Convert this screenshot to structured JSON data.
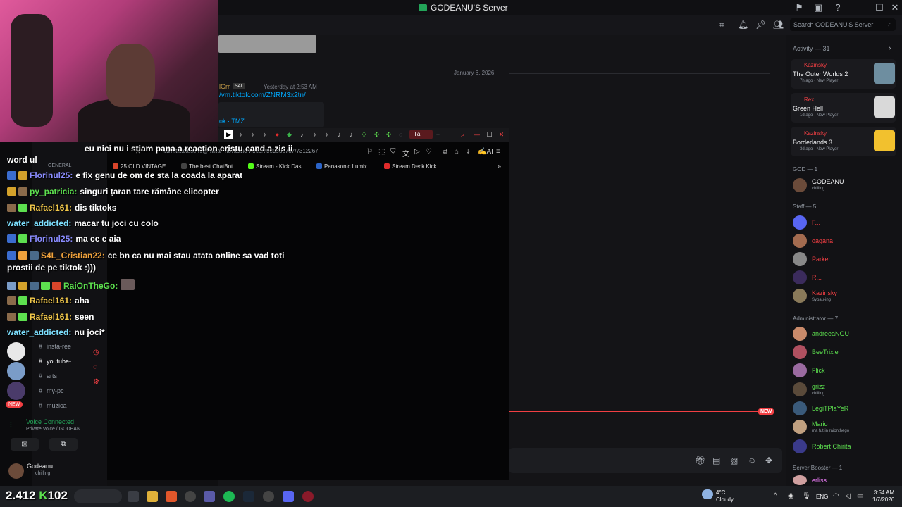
{
  "window": {
    "title": "GODEANU'S Server",
    "minimize": "—",
    "maximize": "☐",
    "close": "✕"
  },
  "header": {
    "search_placeholder": "Search GODEANU'S Server"
  },
  "chat": {
    "date_divider": "January 6, 2026",
    "message": {
      "author": "lGrr",
      "badge": "S4L",
      "time": "Yesterday at 2:53 AM",
      "link": "/vm.tiktok.com/ZNRM3x2tn/",
      "embed_title": "ok · TMZ"
    },
    "new_label": "NEW"
  },
  "browser": {
    "active_tab": "Tă",
    "new_tab": "+",
    "url": "www.tiktok.com/@mihai_novitovic/video/7589336787/7312267",
    "ai_label": "AI",
    "bookmarks": [
      {
        "label": "25 OLD VINTAGE...",
        "color": "#d9452b"
      },
      {
        "label": "The best ChatBot...",
        "color": "#444444"
      },
      {
        "label": "Stream - Kick Das...",
        "color": "#53fc18"
      },
      {
        "label": "Panasonic Lumix...",
        "color": "#2b64c8"
      },
      {
        "label": "Stream Deck Kick...",
        "color": "#e02b2b"
      }
    ]
  },
  "channels": [
    {
      "name": "insta-ree"
    },
    {
      "name": "youtube-"
    },
    {
      "name": "arts"
    },
    {
      "name": "my-pc"
    },
    {
      "name": "muzica"
    }
  ],
  "channel_category": "GENERAL",
  "voice": {
    "status": "Voice Connected",
    "location": "Private Voice / GODEAN"
  },
  "user": {
    "name": "Godeanu",
    "status": "chilling"
  },
  "overlay_chat": [
    {
      "user": "",
      "text": "eu nici nu i stiam pana a reaction cristu cand a zis ii",
      "color": "#ffffff"
    },
    {
      "user": "",
      "text": "word ul",
      "color": "#ffffff"
    },
    {
      "user": "Florinul25:",
      "text": "e fix genu de om de sta la coada la aparat",
      "color": "#8a8cff"
    },
    {
      "user": "py_patricia:",
      "text": "singuri țaran tare rămâne elicopter",
      "color": "#5de04f"
    },
    {
      "user": "Rafael161:",
      "text": "dis tiktoks",
      "color": "#f2c84a"
    },
    {
      "user": "water_addicted:",
      "text": "macar tu joci cu colo",
      "color": "#7de0ff"
    },
    {
      "user": "Florinul25:",
      "text": "ma ce e aia",
      "color": "#8a8cff"
    },
    {
      "user": "S4L_Cristian22:",
      "text": "ce bn ca nu mai stau atata online sa vad toti",
      "color": "#f0a23c"
    },
    {
      "user": "",
      "text": "prostii de pe tiktok :)))",
      "color": "#ffffff"
    },
    {
      "user": "RaiOnTheGo:",
      "text": "",
      "color": "#5de04f"
    },
    {
      "user": "Rafael161:",
      "text": "aha",
      "color": "#f2c84a"
    },
    {
      "user": "Rafael161:",
      "text": "seen",
      "color": "#f2c84a"
    },
    {
      "user": "water_addicted:",
      "text": "nu joci*",
      "color": "#7de0ff"
    }
  ],
  "members": {
    "activity_header": "Activity — 31",
    "activities": [
      {
        "user": "Kazinsky",
        "game": "The Outer Worlds 2",
        "sub": "7h ago",
        "tag": "New Player",
        "thumb_color": "#6e8ea0"
      },
      {
        "user": "Rex",
        "game": "Green Hell",
        "sub": "1d ago",
        "tag": "New Player",
        "thumb_color": "#d9d9d9"
      },
      {
        "user": "Kazinsky",
        "game": "Borderlands 3",
        "sub": "3d ago",
        "tag": "New Player",
        "thumb_color": "#f2c12e"
      }
    ],
    "god_header": "GOD — 1",
    "god": [
      {
        "name": "GODEANU",
        "status": "chilling",
        "color": "#f2f3f5",
        "av": "#6b4b3a"
      }
    ],
    "staff_header": "Staff — 5",
    "staff": [
      {
        "name": "F...",
        "status": "",
        "color": "#f23f43",
        "av": "#5865f2"
      },
      {
        "name": "oagana",
        "status": "",
        "color": "#f23f43",
        "av": "#a36b4f"
      },
      {
        "name": "Parker",
        "status": "",
        "color": "#f23f43",
        "av": "#888888"
      },
      {
        "name": "R...",
        "status": "",
        "color": "#f23f43",
        "av": "#3b2b5c"
      },
      {
        "name": "Kazinsky",
        "status": "Sybau-ing",
        "color": "#f23f43",
        "av": "#8a7a5a"
      }
    ],
    "admin_header": "Administrator — 7",
    "admins": [
      {
        "name": "andreeaNGU",
        "status": "",
        "color": "#5de04f",
        "av": "#c98a6a"
      },
      {
        "name": "BeeTrixie",
        "status": "",
        "color": "#5de04f",
        "av": "#b05060"
      },
      {
        "name": "Flick",
        "status": "",
        "color": "#5de04f",
        "av": "#9a6aa0"
      },
      {
        "name": "grizz",
        "status": "chilling",
        "color": "#5de04f",
        "av": "#5a4a3a"
      },
      {
        "name": "LegiTPlaYeR",
        "status": "",
        "color": "#5de04f",
        "av": "#3a5a7a"
      },
      {
        "name": "Mario",
        "status": "ma fut in raionthego",
        "color": "#5de04f",
        "av": "#c0a080"
      },
      {
        "name": "Robert Chirita",
        "status": "",
        "color": "#5de04f",
        "av": "#3a3a8a"
      }
    ],
    "booster_header": "Server Booster — 1",
    "boosters": [
      {
        "name": "erliss",
        "status": "",
        "color": "#f47fff",
        "av": "#d0a0a0"
      }
    ]
  },
  "taskbar": {
    "counter_left": "2.412",
    "counter_right": "102",
    "weather_temp": "4°C",
    "weather_desc": "Cloudy",
    "lang": "ENG",
    "time": "3:54 AM",
    "date": "1/7/2026"
  }
}
